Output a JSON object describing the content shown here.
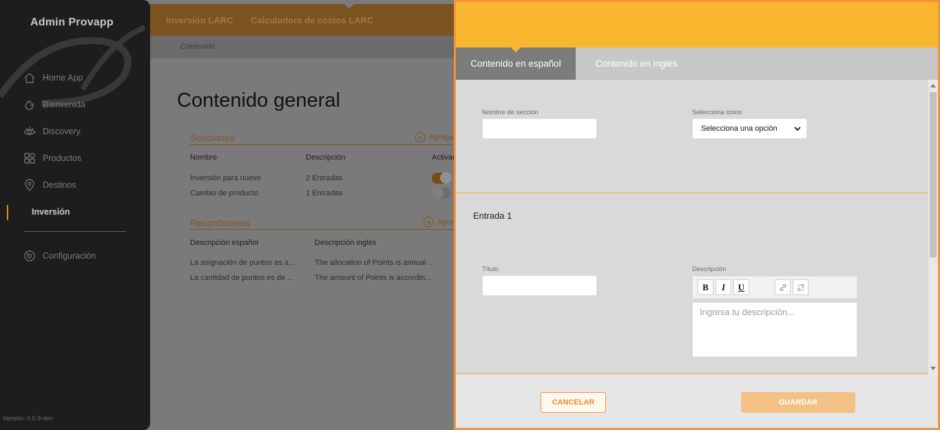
{
  "app": {
    "title": "Admin Provapp",
    "version": "Versión: 0.0.9-dev"
  },
  "sidebar": {
    "items": [
      {
        "label": "Home App",
        "icon": "home-icon"
      },
      {
        "label": "Bienvenida",
        "icon": "wave-hand-icon"
      },
      {
        "label": "Discovery",
        "icon": "eye-icon"
      },
      {
        "label": "Productos",
        "icon": "grid-icon"
      },
      {
        "label": "Destinos",
        "icon": "pin-icon"
      },
      {
        "label": "Inversión",
        "icon": "",
        "active": true
      },
      {
        "label": "Configuración",
        "icon": "gear-icon"
      }
    ]
  },
  "topbar": {
    "tabs": [
      "Inversión LARC",
      "Calculadora de costos LARC"
    ],
    "breadcrumb": "Contenido"
  },
  "main": {
    "title": "Contenido general",
    "sections": {
      "title": "Secciones",
      "add_label": "Agrega",
      "headers": [
        "Nombre",
        "Descripción",
        "Activar"
      ],
      "rows": [
        {
          "name": "Inversión para nuevo",
          "desc": "2 Entradas",
          "active": true
        },
        {
          "name": "Cambio de producto",
          "desc": "1 Entradas",
          "active": false
        }
      ]
    },
    "reminders": {
      "title": "Recordatorios",
      "add_label": "Agre",
      "headers": [
        "Descripción español",
        "Descripción inglés"
      ],
      "rows": [
        {
          "es": "La asignación de puntos es a...",
          "en": "The allocation of Points is annual ..."
        },
        {
          "es": "La cantidad de puntos es de ...",
          "en": "The amount of Points is accordin..."
        }
      ]
    }
  },
  "panel": {
    "tabs": [
      "Contenido en español",
      "Contenido en inglés"
    ],
    "section_name_label": "Nombre de sección",
    "section_name_value": "",
    "icon_label": "Selecciona ícono",
    "icon_select_value": "Selecciona una opción",
    "entry_title": "Entrada 1",
    "title_label": "Título",
    "title_value": "",
    "description_label": "Descripción",
    "description_placeholder": "Ingresa tu descripción...",
    "editor_buttons": {
      "bold": "B",
      "italic": "I",
      "underline": "U"
    },
    "cancel_label": "CANCELAR",
    "save_label": "GUARDAR"
  },
  "colors": {
    "accent": "#f9b72f",
    "border": "#f5923a",
    "save": "#f3c185",
    "sidebar": "#1d1d1d"
  }
}
